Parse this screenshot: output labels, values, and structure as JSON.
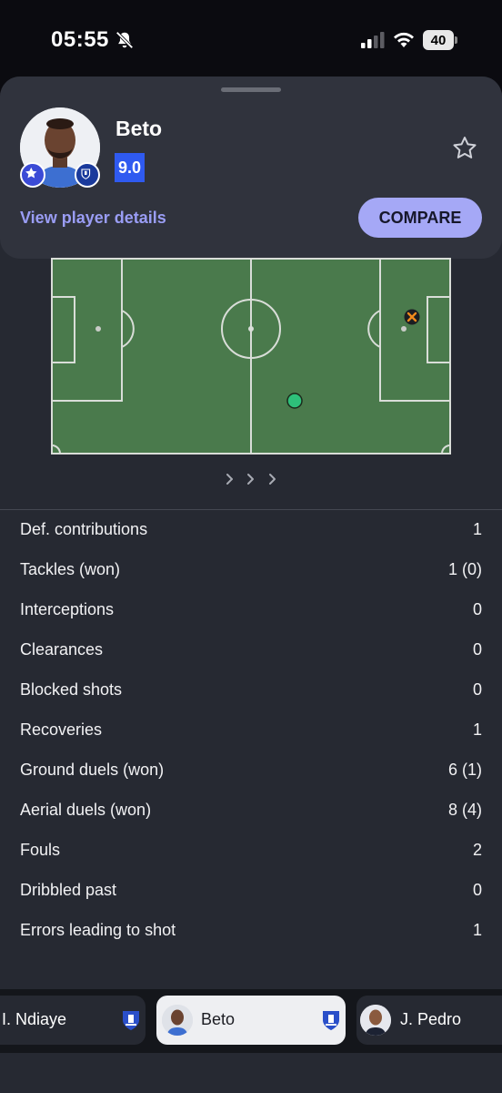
{
  "status_bar": {
    "time": "05:55",
    "battery": "40",
    "icons": [
      "bell-off-icon",
      "signal-icon",
      "wifi-icon",
      "battery-icon"
    ]
  },
  "player": {
    "name": "Beto",
    "rating": "9.0",
    "details_link": "View player details",
    "compare_label": "COMPARE",
    "icons": [
      "star-badge-icon",
      "everton-crest-icon",
      "favorite-star-icon"
    ]
  },
  "colors": {
    "accent": "#a5a8f6",
    "rating_bg": "#2f5af0",
    "pitch": "#4a7a4c",
    "marker_action": "#2ec07a",
    "marker_miss": "#f08a1c"
  },
  "stats": [
    {
      "label": "Def. contributions",
      "value": "1"
    },
    {
      "label": "Tackles (won)",
      "value": "1 (0)"
    },
    {
      "label": "Interceptions",
      "value": "0"
    },
    {
      "label": "Clearances",
      "value": "0"
    },
    {
      "label": "Blocked shots",
      "value": "0"
    },
    {
      "label": "Recoveries",
      "value": "1"
    },
    {
      "label": "Ground duels (won)",
      "value": "6 (1)"
    },
    {
      "label": "Aerial duels (won)",
      "value": "8 (4)"
    },
    {
      "label": "Fouls",
      "value": "2"
    },
    {
      "label": "Dribbled past",
      "value": "0"
    },
    {
      "label": "Errors leading to shot",
      "value": "1"
    }
  ],
  "player_switcher": [
    {
      "name": "I. Ndiaye",
      "active": false
    },
    {
      "name": "Beto",
      "active": true
    },
    {
      "name": "J. Pedro",
      "active": false
    }
  ]
}
